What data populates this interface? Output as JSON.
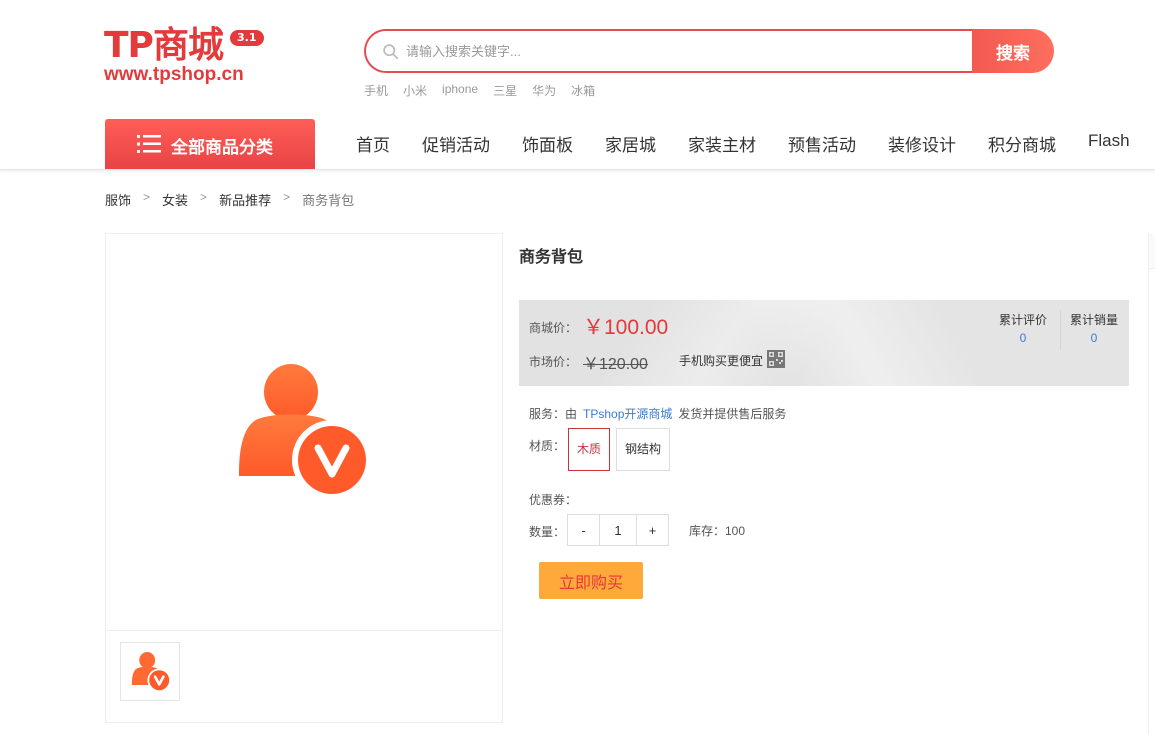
{
  "logo": {
    "main": "TP商城",
    "version": "3.1",
    "url": "www.tpshop.cn"
  },
  "search": {
    "placeholder": "请输入搜索关键字...",
    "button": "搜索",
    "hot_words": [
      "手机",
      "小米",
      "iphone",
      "三星",
      "华为",
      "冰箱"
    ]
  },
  "nav": {
    "category_button": "全部商品分类",
    "items": [
      "首页",
      "促销活动",
      "饰面板",
      "家居城",
      "家装主材",
      "预售活动",
      "装修设计",
      "积分商城",
      "Flash"
    ]
  },
  "breadcrumb": [
    "服饰",
    "女装",
    "新品推荐",
    "商务背包"
  ],
  "product": {
    "title": "商务背包",
    "price_label": "商城价：",
    "price": "￥100.00",
    "market_label": "市场价：",
    "market_price": "￥120.00",
    "mobile_text": "手机购买更便宜",
    "review_label": "累计评价",
    "review_count": "0",
    "sales_label": "累计销量",
    "sales_count": "0",
    "service_label": "服务：由",
    "service_store": "TPshop开源商城",
    "service_suffix": "发货并提供售后服务",
    "material_label": "材质：",
    "materials": [
      "木质",
      "钢结构"
    ],
    "coupon_label": "优惠券：",
    "qty_label": "数量：",
    "qty_minus": "-",
    "qty_value": "1",
    "qty_plus": "+",
    "stock_text": "库存：100",
    "buy_button": "立即购买"
  },
  "colors": {
    "brand": "#e33b3b",
    "price": "#e4393c",
    "link": "#3a7bd5",
    "buy": "#ffa93a"
  },
  "icons": {
    "search": "search-icon",
    "menu": "menu-icon",
    "qr": "qr-code-icon",
    "product": "verified-user-icon"
  }
}
